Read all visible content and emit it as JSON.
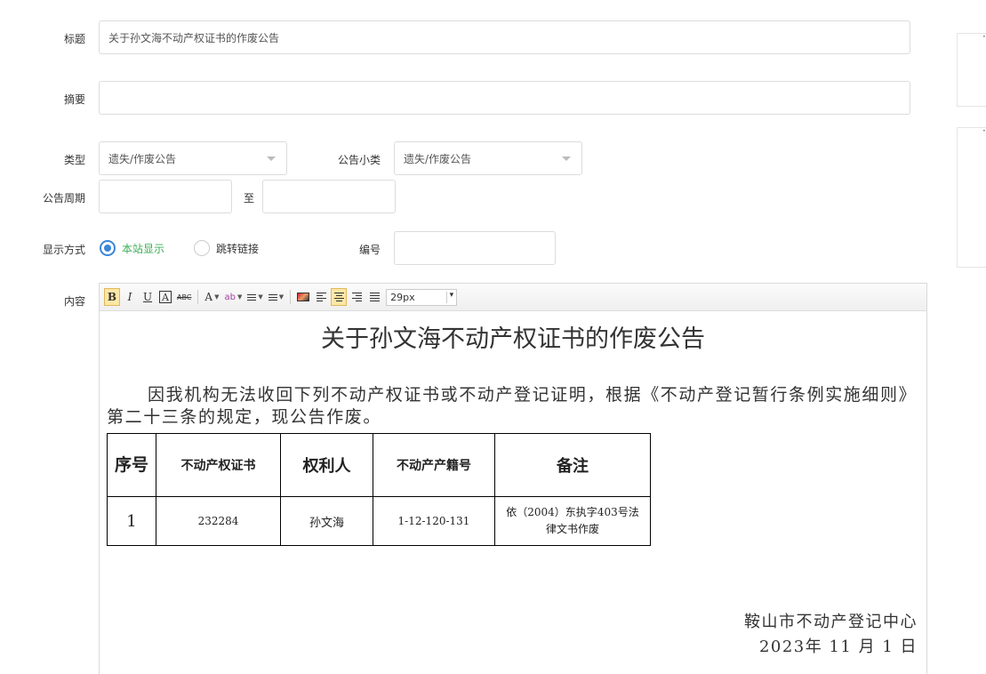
{
  "form": {
    "title_label": "标题",
    "title_value": "关于孙文海不动产权证书的作废公告",
    "summary_label": "摘要",
    "summary_value": "",
    "type_label": "类型",
    "type_value": "遗失/作废公告",
    "subtype_label": "公告小类",
    "subtype_value": "遗失/作废公告",
    "period_label": "公告周期",
    "period_start": "",
    "period_to": "至",
    "period_end": "",
    "display_label": "显示方式",
    "display_options": [
      "本站显示",
      "跳转链接"
    ],
    "display_selected": "本站显示",
    "number_label": "编号",
    "number_value": "",
    "content_label": "内容"
  },
  "toolbar": {
    "bold": "B",
    "italic": "I",
    "underline": "U",
    "border_text": "A",
    "strikethrough": "ABC",
    "font_color": "A",
    "highlight": "ab",
    "font_size": "29px"
  },
  "document": {
    "title": "关于孙文海不动产权证书的作废公告",
    "paragraph": "因我机构无法收回下列不动产权证书或不动产登记证明，根据《不动产登记暂行条例实施细则》第二十三条的规定，现公告作废。",
    "table": {
      "headers": [
        "序号",
        "不动产权证书",
        "权利人",
        "不动产产籍号",
        "备注"
      ],
      "rows": [
        [
          "1",
          "232284",
          "孙文海",
          "1-12-120-131",
          "依（2004）东执字403号法律文书作废"
        ]
      ]
    },
    "signature_org": "鞍山市不动产登记中心",
    "signature_date": "2023年 11 月 1 日"
  },
  "colors": {
    "radio_accent": "#3c86d6",
    "selected_text": "#3cae56",
    "active_tool": "#ffe7a5"
  }
}
